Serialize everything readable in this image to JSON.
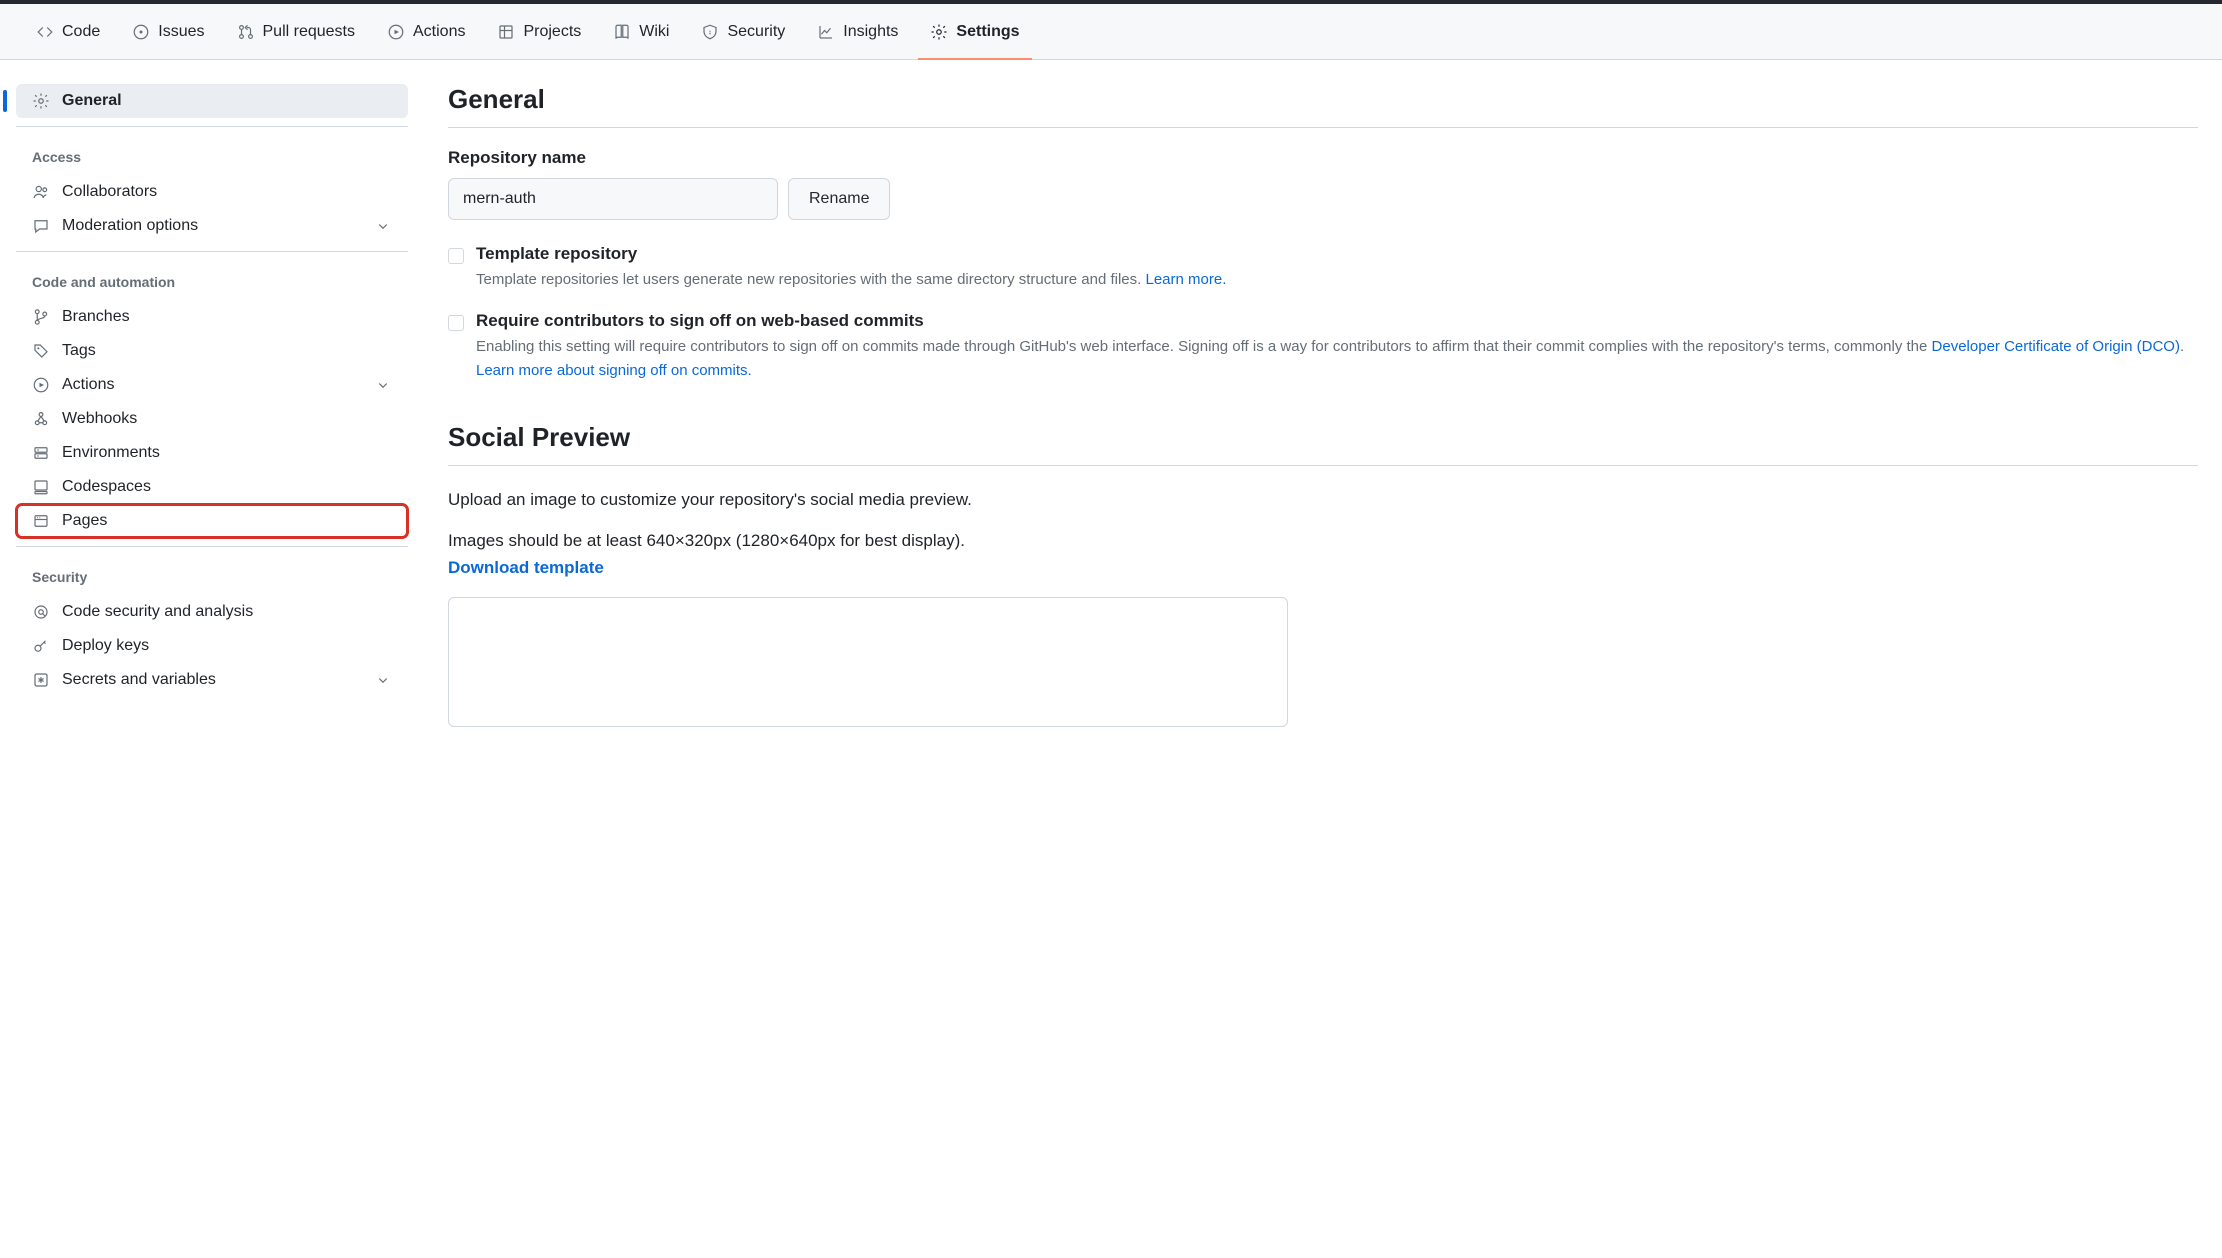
{
  "nav": [
    {
      "label": "Code",
      "icon": "code-icon"
    },
    {
      "label": "Issues",
      "icon": "issue-icon"
    },
    {
      "label": "Pull requests",
      "icon": "pr-icon"
    },
    {
      "label": "Actions",
      "icon": "play-circle-icon"
    },
    {
      "label": "Projects",
      "icon": "table-icon"
    },
    {
      "label": "Wiki",
      "icon": "book-icon"
    },
    {
      "label": "Security",
      "icon": "shield-icon"
    },
    {
      "label": "Insights",
      "icon": "graph-icon"
    },
    {
      "label": "Settings",
      "icon": "gear-icon",
      "active": true
    }
  ],
  "sidebar": {
    "general": "General",
    "access_heading": "Access",
    "access": {
      "collaborators": "Collaborators",
      "moderation": "Moderation options"
    },
    "code_heading": "Code and automation",
    "code": {
      "branches": "Branches",
      "tags": "Tags",
      "actions": "Actions",
      "webhooks": "Webhooks",
      "environments": "Environments",
      "codespaces": "Codespaces",
      "pages": "Pages"
    },
    "security_heading": "Security",
    "security": {
      "analysis": "Code security and analysis",
      "deploy_keys": "Deploy keys",
      "secrets": "Secrets and variables"
    }
  },
  "general": {
    "heading": "General",
    "repo_name_label": "Repository name",
    "repo_name_value": "mern-auth",
    "rename_btn": "Rename",
    "template": {
      "title": "Template repository",
      "desc": "Template repositories let users generate new repositories with the same directory structure and files. ",
      "link": "Learn more."
    },
    "signoff": {
      "title": "Require contributors to sign off on web-based commits",
      "desc1": "Enabling this setting will require contributors to sign off on commits made through GitHub's web interface. Signing off is a way for contributors to affirm that their commit complies with the repository's terms, commonly the ",
      "link1": "Developer Certificate of Origin (DCO)",
      "desc2": ". ",
      "link2": "Learn more about signing off on commits."
    },
    "social": {
      "heading": "Social Preview",
      "desc1": "Upload an image to customize your repository's social media preview.",
      "desc2": "Images should be at least 640×320px (1280×640px for best display).",
      "download": "Download template"
    }
  }
}
